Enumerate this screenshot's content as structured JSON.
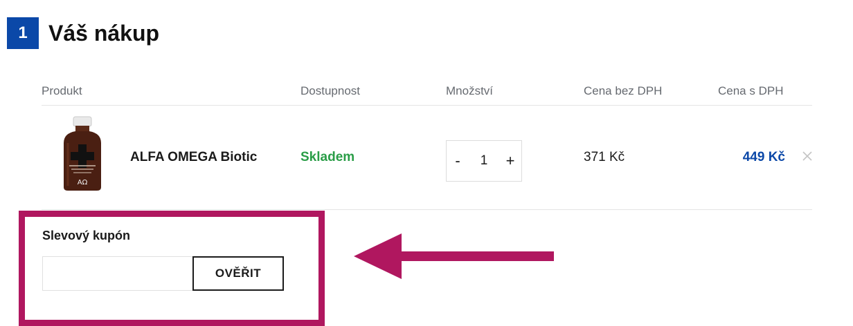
{
  "header": {
    "step_number": "1",
    "title": "Váš nákup"
  },
  "table": {
    "columns": {
      "product": "Produkt",
      "availability": "Dostupnost",
      "quantity": "Množství",
      "price_net": "Cena bez DPH",
      "price_gross": "Cena s DPH"
    },
    "rows": [
      {
        "product_name": "ALFA OMEGA Biotic",
        "image_label": "ΑΩ",
        "availability": "Skladem",
        "quantity": "1",
        "qty_minus": "-",
        "qty_plus": "+",
        "price_net": "371 Kč",
        "price_gross": "449 Kč"
      }
    ]
  },
  "coupon": {
    "label": "Slevový kupón",
    "input_value": "",
    "input_placeholder": "",
    "submit_label": "OVĚŘIT"
  },
  "colors": {
    "brand_blue": "#0b48a8",
    "stock_green": "#2a9d47",
    "highlight_magenta": "#b0175f"
  },
  "icons": {
    "remove": "close-icon",
    "annotation": "arrow-left-icon"
  }
}
